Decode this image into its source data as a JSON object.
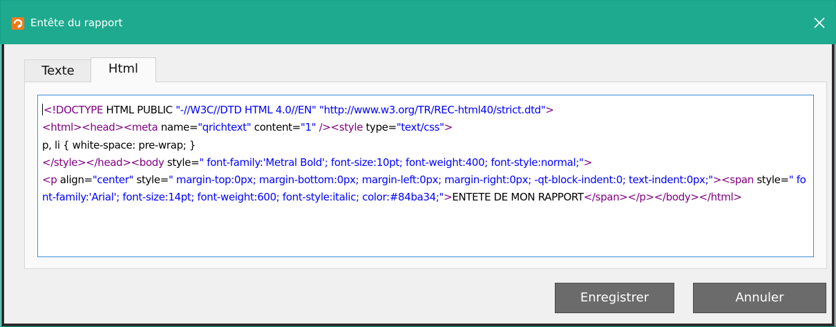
{
  "window": {
    "title": "Entête du rapport"
  },
  "tabs": [
    {
      "label": "Texte",
      "active": false
    },
    {
      "label": "Html",
      "active": true
    }
  ],
  "editor": {
    "segments": [
      {
        "k": "t",
        "s": "<!DOCTYPE"
      },
      {
        "k": "n",
        "s": " HTML PUBLIC "
      },
      {
        "k": "v",
        "s": "\"-//W3C//DTD HTML 4.0//EN\""
      },
      {
        "k": "n",
        "s": " "
      },
      {
        "k": "v",
        "s": "\"http://www.w3.org/TR/REC-html40/strict.dtd\""
      },
      {
        "k": "t",
        "s": ">"
      },
      {
        "k": "n",
        "s": "\n"
      },
      {
        "k": "t",
        "s": "<html><head><meta"
      },
      {
        "k": "n",
        "s": " name="
      },
      {
        "k": "v",
        "s": "\"qrichtext\""
      },
      {
        "k": "n",
        "s": " content="
      },
      {
        "k": "v",
        "s": "\"1\""
      },
      {
        "k": "n",
        "s": " "
      },
      {
        "k": "t",
        "s": "/><style"
      },
      {
        "k": "n",
        "s": " type="
      },
      {
        "k": "v",
        "s": "\"text/css\""
      },
      {
        "k": "t",
        "s": ">"
      },
      {
        "k": "n",
        "s": "\np, li { white-space: pre-wrap; }\n"
      },
      {
        "k": "t",
        "s": "</style></head><body"
      },
      {
        "k": "n",
        "s": " style="
      },
      {
        "k": "v",
        "s": "\" font-family:'Metral Bold'; font-size:10pt; font-weight:400; font-style:normal;\""
      },
      {
        "k": "t",
        "s": ">"
      },
      {
        "k": "n",
        "s": "\n"
      },
      {
        "k": "t",
        "s": "<p"
      },
      {
        "k": "n",
        "s": " align="
      },
      {
        "k": "v",
        "s": "\"center\""
      },
      {
        "k": "n",
        "s": " style="
      },
      {
        "k": "v",
        "s": "\" margin-top:0px; margin-bottom:0px; margin-left:0px; margin-right:0px; -qt-block-indent:0; text-indent:0px;\""
      },
      {
        "k": "t",
        "s": "><span"
      },
      {
        "k": "n",
        "s": " style="
      },
      {
        "k": "v",
        "s": "\" font-family:'Arial'; font-size:14pt; font-weight:600; font-style:italic; color:#84ba34;\""
      },
      {
        "k": "t",
        "s": ">"
      },
      {
        "k": "n",
        "s": "ENTETE DE MON RAPPORT"
      },
      {
        "k": "t",
        "s": "</span></p></body></html>"
      }
    ]
  },
  "buttons": {
    "save": "Enregistrer",
    "cancel": "Annuler"
  },
  "icons": {
    "app": "report-app-icon",
    "close": "close-icon"
  },
  "colors": {
    "titlebar": "#1eaa8f",
    "tag": "#800080",
    "value": "#0000ff",
    "focus_border": "#3c8fd8",
    "button": "#6b6b6b"
  }
}
